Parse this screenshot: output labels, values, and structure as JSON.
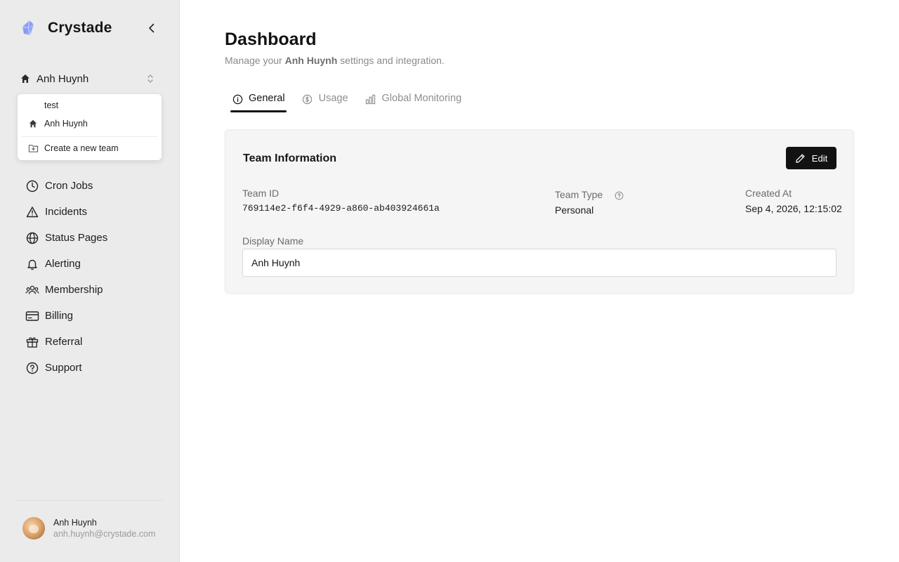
{
  "sidebar": {
    "brand_name": "Crystade",
    "team_switcher": {
      "current": "Anh Huynh"
    },
    "team_menu": {
      "items": [
        {
          "label": "test"
        },
        {
          "label": "Anh Huynh"
        }
      ],
      "create_label": "Create a new team"
    },
    "nav": [
      {
        "label": "Cron Jobs",
        "icon": "clock-icon"
      },
      {
        "label": "Incidents",
        "icon": "warning-icon"
      },
      {
        "label": "Status Pages",
        "icon": "globe-icon"
      },
      {
        "label": "Alerting",
        "icon": "bell-icon"
      },
      {
        "label": "Membership",
        "icon": "users-icon"
      },
      {
        "label": "Billing",
        "icon": "credit-card-icon"
      },
      {
        "label": "Referral",
        "icon": "gift-icon"
      },
      {
        "label": "Support",
        "icon": "help-circle-icon"
      }
    ],
    "user": {
      "name": "Anh Huynh",
      "email": "anh.huynh@crystade.com"
    }
  },
  "main": {
    "title": "Dashboard",
    "subtitle": {
      "prefix": "Manage your ",
      "team": "Anh Huynh",
      "suffix": " settings and integration."
    },
    "tabs": [
      {
        "label": "General",
        "icon": "info-icon",
        "active": true
      },
      {
        "label": "Usage",
        "icon": "dollar-icon",
        "active": false
      },
      {
        "label": "Global Monitoring",
        "icon": "bar-chart-icon",
        "active": false
      }
    ],
    "card": {
      "title": "Team Information",
      "edit_label": "Edit",
      "team_id_label": "Team ID",
      "team_id": "769114e2-f6f4-4929-a860-ab403924661a",
      "team_type_label": "Team Type",
      "team_type": "Personal",
      "created_at_label": "Created At",
      "created_at": "Sep 4, 2026, 12:15:02",
      "display_name_label": "Display Name",
      "display_name": "Anh Huynh"
    }
  },
  "colors": {
    "accent": "#121212",
    "sidebar_bg": "#ebebeb",
    "card_bg": "#f5f5f5",
    "muted_text": "#8a8a8a"
  }
}
